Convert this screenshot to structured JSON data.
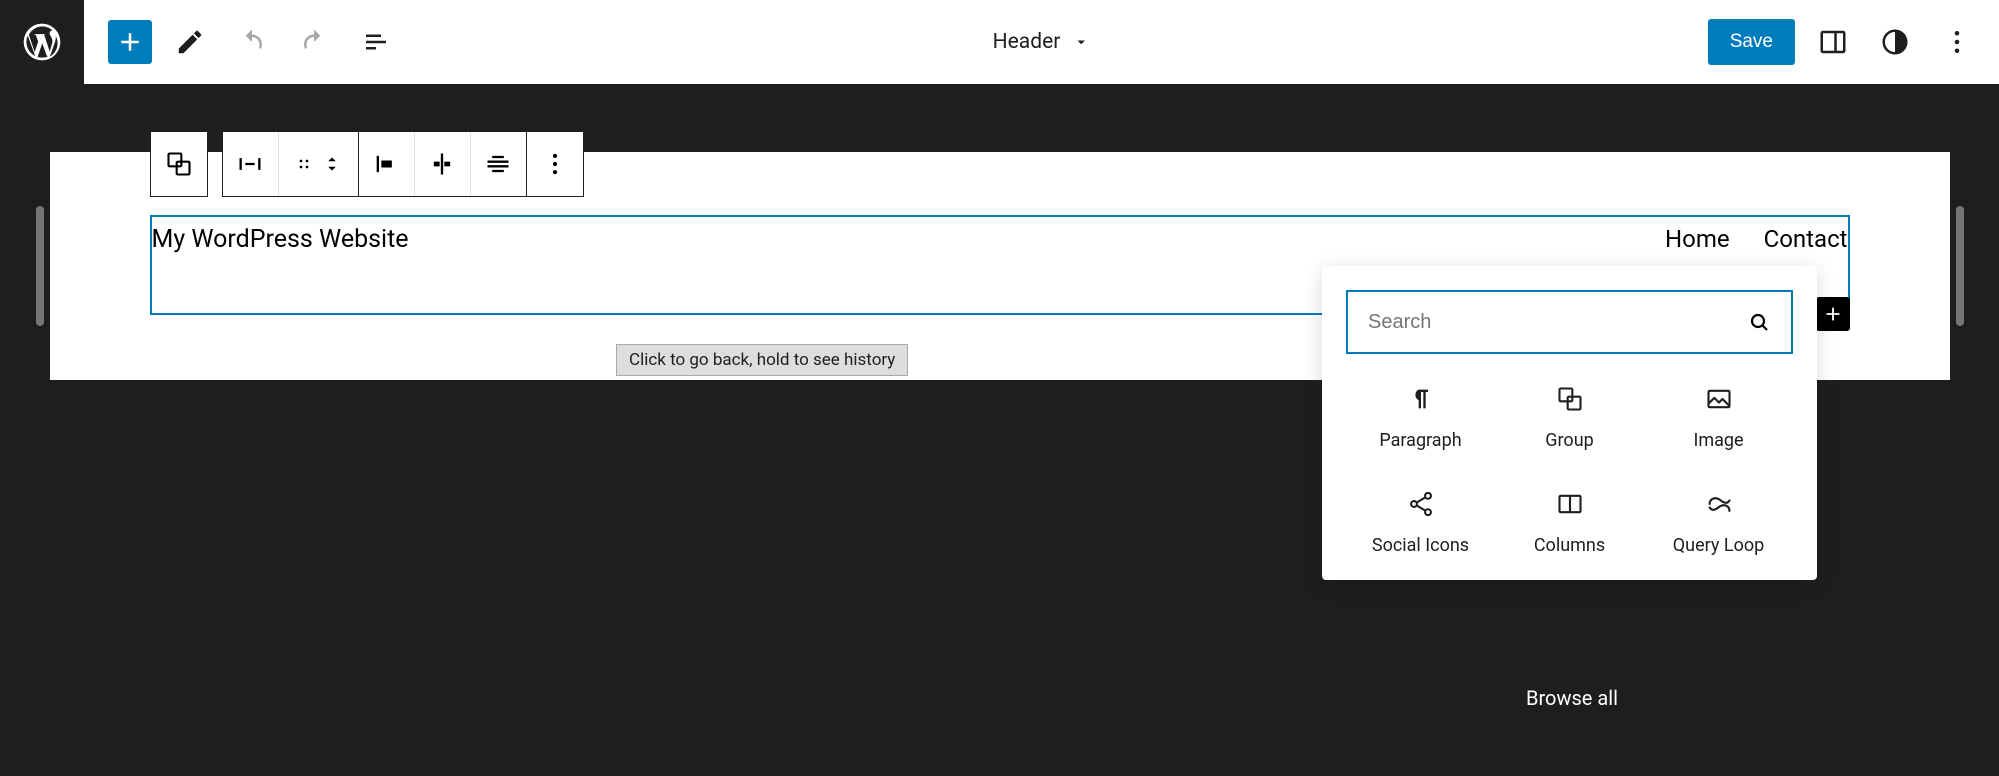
{
  "toolbar": {
    "save_label": "Save",
    "title": "Header"
  },
  "header_block": {
    "site_title": "My WordPress Website",
    "nav": [
      "Home",
      "Contact"
    ]
  },
  "tooltip": "Click to go back, hold to see history",
  "inserter": {
    "search_placeholder": "Search",
    "blocks": [
      {
        "label": "Paragraph",
        "icon": "pilcrow"
      },
      {
        "label": "Group",
        "icon": "group"
      },
      {
        "label": "Image",
        "icon": "image"
      },
      {
        "label": "Social Icons",
        "icon": "share"
      },
      {
        "label": "Columns",
        "icon": "columns"
      },
      {
        "label": "Query Loop",
        "icon": "loop"
      }
    ],
    "browse_all": "Browse all"
  }
}
